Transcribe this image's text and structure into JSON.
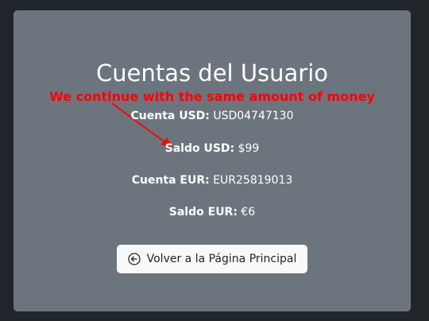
{
  "card": {
    "title": "Cuentas del Usuario",
    "annotation": "We continue with the same amount of money",
    "rows": [
      {
        "label": "Cuenta USD:",
        "value": "USD04747130"
      },
      {
        "label": "Saldo USD:",
        "value": "$99"
      },
      {
        "label": "Cuenta EUR:",
        "value": "EUR25819013"
      },
      {
        "label": "Saldo EUR:",
        "value": "€6"
      }
    ],
    "back_button": {
      "label": "Volver a la Página Principal",
      "icon": "arrow-left-circle-icon"
    }
  },
  "colors": {
    "page_background": "#212529",
    "card_background": "#6c757d",
    "annotation": "#ff0000",
    "button_background": "#f8f9fa"
  }
}
